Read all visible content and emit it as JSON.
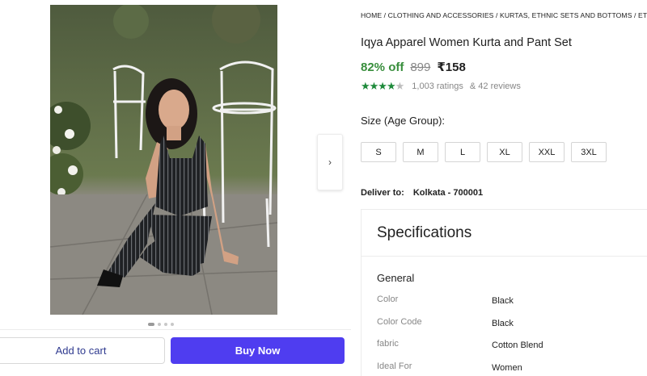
{
  "gallery": {
    "image_alt": "Woman in black striped sleeveless kurta and pant set seated on stone patio",
    "next_icon": "chevron-right-icon",
    "dots_total": 4,
    "dots_active": 0
  },
  "actions": {
    "add_to_cart": "Add to cart",
    "buy_now": "Buy Now"
  },
  "breadcrumb": [
    "HOME",
    "CLOTHING AND ACCESSORIES",
    "KURTAS, ETHNIC SETS AND BOTTOMS",
    "ETHNIC SETS"
  ],
  "product": {
    "title": "Iqya Apparel Women Kurta and Pant Set",
    "discount": "82% off",
    "mrp": "899",
    "price": "₹158",
    "rating_stars": 4.5,
    "ratings": "1,003 ratings",
    "reviews": "& 42 reviews"
  },
  "size": {
    "label": "Size (Age Group):",
    "options": [
      "S",
      "M",
      "L",
      "XL",
      "XXL",
      "3XL"
    ]
  },
  "delivery": {
    "label": "Deliver to:",
    "location": "Kolkata - 700001"
  },
  "specifications": {
    "title": "Specifications",
    "group": "General",
    "rows": [
      {
        "key": "Color",
        "value": "Black"
      },
      {
        "key": "Color Code",
        "value": "Black"
      },
      {
        "key": "fabric",
        "value": "Cotton Blend"
      },
      {
        "key": "Ideal For",
        "value": "Women"
      }
    ]
  },
  "colors": {
    "discount_green": "#388e3c",
    "star_green": "#1d8a3a",
    "buy_button": "#4f3df0",
    "cart_text": "#2f3a8f"
  }
}
